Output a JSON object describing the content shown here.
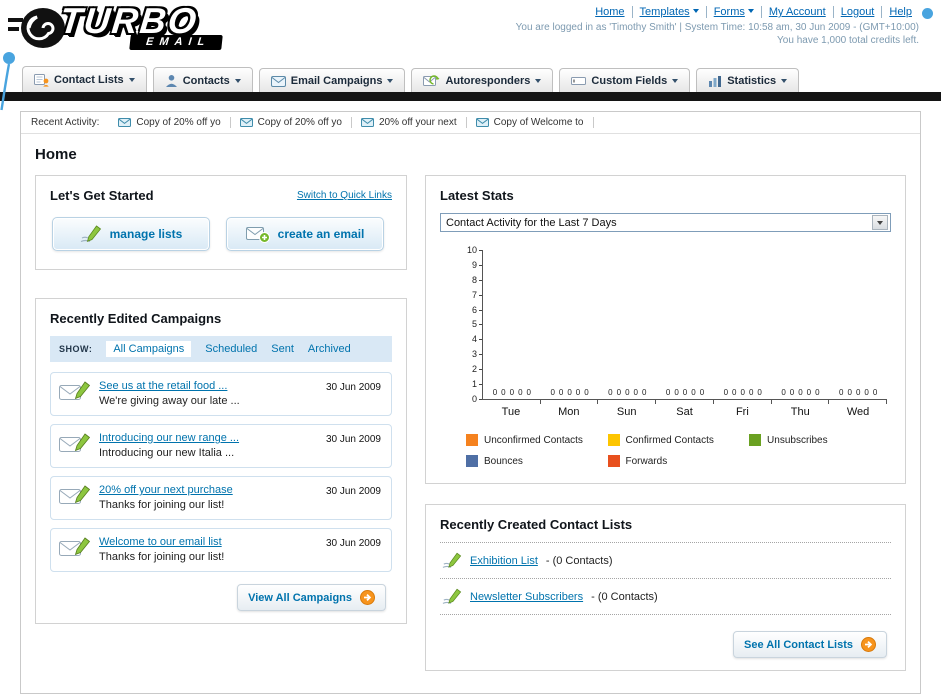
{
  "header": {
    "logo": {
      "word": "TURBO",
      "sub": "EMAIL"
    },
    "top_links": [
      {
        "label": "Home"
      },
      {
        "label": "Templates"
      },
      {
        "label": "Forms"
      },
      {
        "label": "My Account"
      },
      {
        "label": "Logout"
      },
      {
        "label": "Help"
      }
    ],
    "session_line": "You are logged in as 'Timothy Smith' | System Time: 10:58 am, 30 Jun 2009 - (GMT+10:00)",
    "credits_line": "You have 1,000 total credits left."
  },
  "nav": {
    "tabs": [
      {
        "label": "Contact Lists"
      },
      {
        "label": "Contacts"
      },
      {
        "label": "Email Campaigns"
      },
      {
        "label": "Autoresponders"
      },
      {
        "label": "Custom Fields"
      },
      {
        "label": "Statistics"
      }
    ]
  },
  "activity_bar": {
    "label": "Recent Activity:",
    "items": [
      "Copy of 20% off yo",
      "Copy of 20% off yo",
      "20% off your next",
      "Copy of Welcome to"
    ]
  },
  "page": {
    "title": "Home"
  },
  "get_started": {
    "title": "Let's Get Started",
    "switch_link": "Switch to Quick Links",
    "manage_lists_label": "manage lists",
    "create_email_label": "create an email"
  },
  "campaigns": {
    "title": "Recently Edited Campaigns",
    "show_label": "SHOW:",
    "filters": [
      "All Campaigns",
      "Scheduled",
      "Sent",
      "Archived"
    ],
    "items": [
      {
        "title": "See us at the retail food ...",
        "subtitle": "We're giving away our late ...",
        "date": "30 Jun 2009"
      },
      {
        "title": "Introducing our new range ...",
        "subtitle": "Introducing our new Italia ...",
        "date": "30 Jun 2009"
      },
      {
        "title": "20% off your next purchase",
        "subtitle": "Thanks for joining our list!",
        "date": "30 Jun 2009"
      },
      {
        "title": "Welcome to our email list",
        "subtitle": "Thanks for joining our list!",
        "date": "30 Jun 2009"
      }
    ],
    "view_all_label": "View All Campaigns"
  },
  "stats": {
    "title": "Latest Stats",
    "selector_value": "Contact Activity for the Last 7 Days",
    "chart_data": {
      "type": "bar",
      "title": "Contact Activity for the Last 7 Days",
      "categories": [
        "Tue",
        "Mon",
        "Sun",
        "Sat",
        "Fri",
        "Thu",
        "Wed"
      ],
      "series": [
        {
          "name": "Unconfirmed Contacts",
          "color": "#f5821f",
          "values": [
            0,
            0,
            0,
            0,
            0,
            0,
            0
          ]
        },
        {
          "name": "Confirmed Contacts",
          "color": "#fdc500",
          "values": [
            0,
            0,
            0,
            0,
            0,
            0,
            0
          ]
        },
        {
          "name": "Unsubscribes",
          "color": "#6aa121",
          "values": [
            0,
            0,
            0,
            0,
            0,
            0,
            0
          ]
        },
        {
          "name": "Bounces",
          "color": "#4f6fa5",
          "values": [
            0,
            0,
            0,
            0,
            0,
            0,
            0
          ]
        },
        {
          "name": "Forwards",
          "color": "#e8501e",
          "values": [
            0,
            0,
            0,
            0,
            0,
            0,
            0
          ]
        }
      ],
      "xlabel": "",
      "ylabel": "",
      "ylim": [
        0,
        10
      ],
      "ytick_step": 1,
      "grid": false,
      "legend_position": "bottom",
      "data_labels_shown": true
    }
  },
  "contact_lists": {
    "title": "Recently Created Contact Lists",
    "items": [
      {
        "name": "Exhibition List",
        "detail": "- (0 Contacts)"
      },
      {
        "name": "Newsletter Subscribers",
        "detail": "- (0 Contacts)"
      }
    ],
    "see_all_label": "See All Contact Lists"
  },
  "colors": {
    "link_blue": "#0073ad",
    "nav_bar_dark": "#141414",
    "accent_orange": "#f7941d",
    "accent_green": "#76b82a",
    "tail_blue": "#49a4df"
  }
}
